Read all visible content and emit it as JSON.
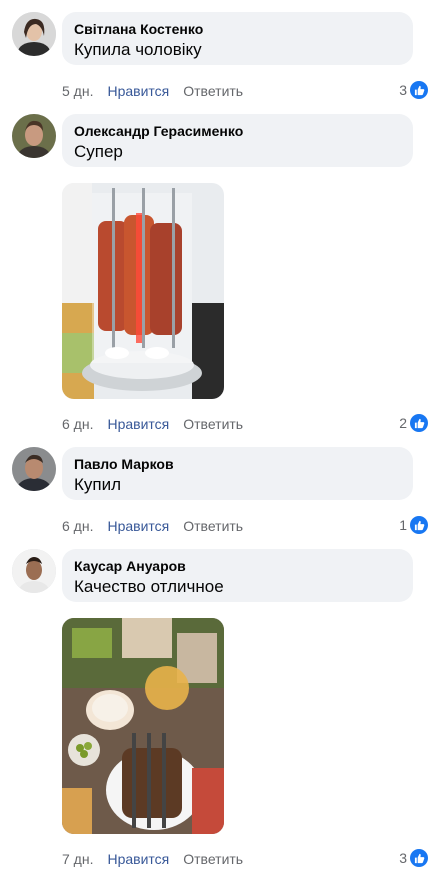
{
  "comments": [
    {
      "author": "Світлана Костенко",
      "text": "Купила чоловіку",
      "time": "5 дн.",
      "like_label": "Нравится",
      "reply_label": "Ответить",
      "reaction_count": "3"
    },
    {
      "author": "Олександр Герасименко",
      "text": "Супер",
      "time": "6 дн.",
      "like_label": "Нравится",
      "reply_label": "Ответить",
      "reaction_count": "2"
    },
    {
      "author": "Павло Марков",
      "text": "Купил",
      "time": "6 дн.",
      "like_label": "Нравится",
      "reply_label": "Ответить",
      "reaction_count": "1"
    },
    {
      "author": "Каусар Ануаров",
      "text": "Качество отличное",
      "time": "7 дн.",
      "like_label": "Нравится",
      "reply_label": "Ответить",
      "reaction_count": "3"
    }
  ],
  "colors": {
    "bubble": "#f0f2f5",
    "link": "#385898",
    "meta": "#65676b",
    "like_badge": "#1877f2"
  },
  "icons": {
    "reaction": "thumbs-up-icon"
  }
}
